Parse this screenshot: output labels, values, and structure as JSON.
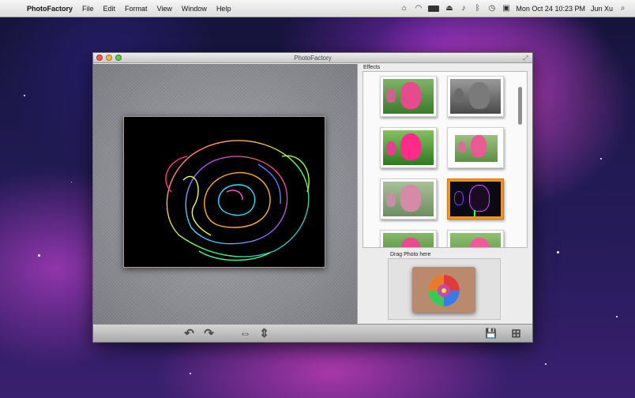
{
  "menubar": {
    "app_name": "PhotoFactory",
    "menus": [
      "File",
      "Edit",
      "Format",
      "View",
      "Window",
      "Help"
    ],
    "clock": "Mon Oct 24  10:23 PM",
    "user": "Jun Xu",
    "icons": [
      "apple-icon",
      "bluetooth-icon",
      "wifi-icon",
      "battery-icon",
      "eject-icon",
      "volume-icon",
      "time-machine-icon",
      "spotlight-icon"
    ]
  },
  "window": {
    "title": "PhotoFactory",
    "effects_label": "Effects",
    "drag_label": "Drag Photo here",
    "selected_effect_index": 5,
    "accent_color": "#f0961e",
    "toolbar": {
      "rotate_left": "↶",
      "rotate_right": "↷",
      "flip_horizontal": "⇔",
      "flip_vertical": "⇕",
      "save": "💾",
      "add": "⊞"
    }
  }
}
